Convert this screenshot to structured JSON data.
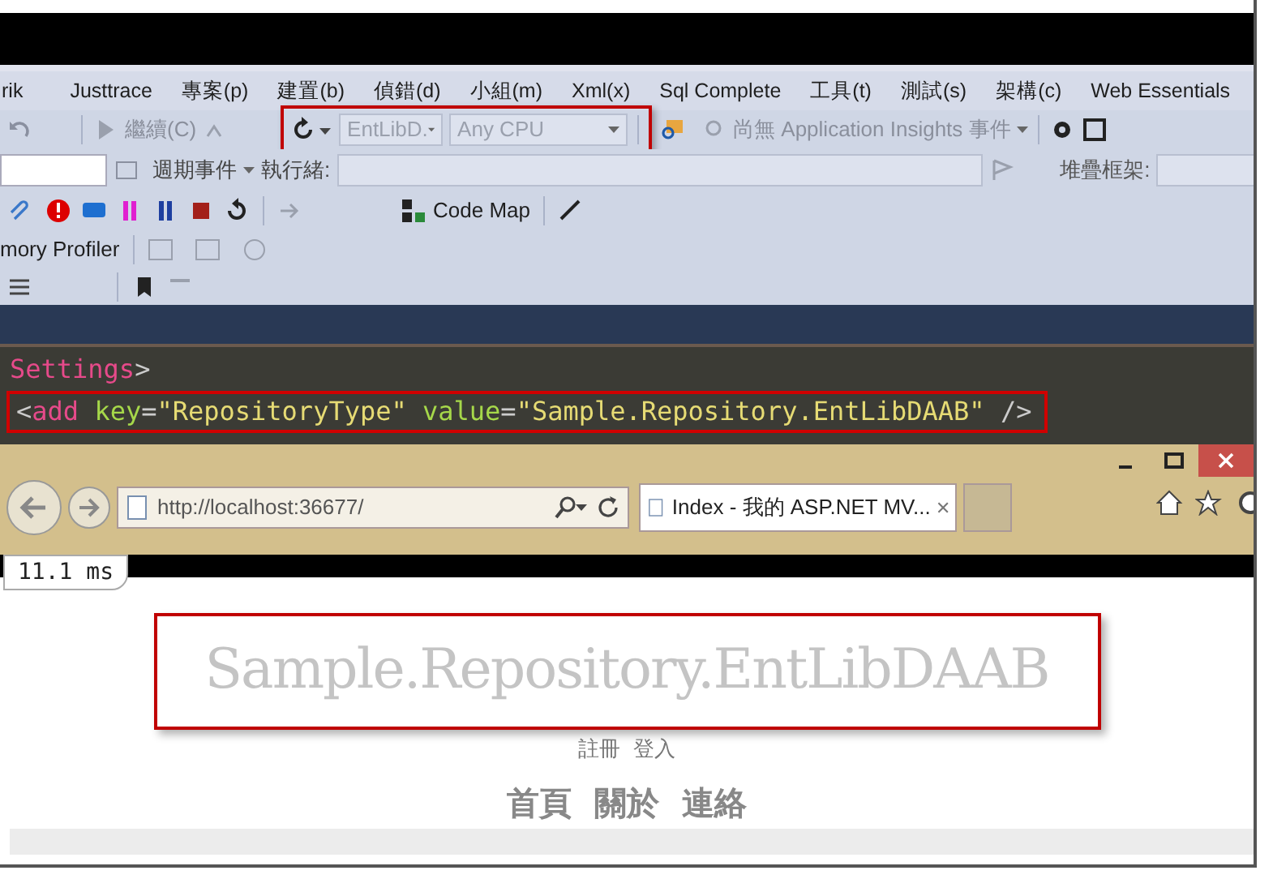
{
  "menu_bar": {
    "items": [
      "rik",
      "Justtrace",
      "專案(p)",
      "建置(b)",
      "偵錯(d)",
      "小組(m)",
      "Xml(x)",
      "Sql Complete",
      "工具(t)",
      "測試(s)",
      "架構(c)",
      "Web Essentials"
    ]
  },
  "toolbar_1": {
    "continue_label": "繼續(C)",
    "config_dropdown": "EntLibD.",
    "platform_dropdown": "Any CPU",
    "insights_dropdown": "尚無 Application Insights 事件"
  },
  "toolbar_2": {
    "lifecycle_label": "週期事件",
    "thread_label": "執行緒:",
    "stack_label": "堆疊框架:"
  },
  "toolbar_3": {
    "code_map_label": "Code Map"
  },
  "toolbar_4": {
    "profiler_label": "mory Profiler"
  },
  "editor": {
    "lines": [
      {
        "highlighted": false,
        "tokens": [
          {
            "kind": "element",
            "text": "Settings"
          },
          {
            "kind": "punct",
            "text": ">"
          }
        ]
      },
      {
        "highlighted": true,
        "tokens": [
          {
            "kind": "punct",
            "text": "<"
          },
          {
            "kind": "element",
            "text": "add"
          },
          {
            "kind": "attr",
            "text": "key"
          },
          {
            "kind": "punct",
            "text": "="
          },
          {
            "kind": "string",
            "text": "\"RepositoryType\""
          },
          {
            "kind": "attr",
            "text": "value"
          },
          {
            "kind": "punct",
            "text": "="
          },
          {
            "kind": "string",
            "text": "\"Sample.Repository.EntLibDAAB\""
          },
          {
            "kind": "punct",
            "text": "/>"
          }
        ]
      }
    ]
  },
  "browser": {
    "address": "http://localhost:36677/",
    "tab_title": "Index - 我的 ASP.NET MV...",
    "timing": "11.1 ms",
    "page": {
      "heading": "Sample.Repository.EntLibDAAB",
      "account_links": [
        "註冊",
        "登入"
      ],
      "nav_links": [
        "首頁",
        "關於",
        "連絡"
      ]
    }
  }
}
